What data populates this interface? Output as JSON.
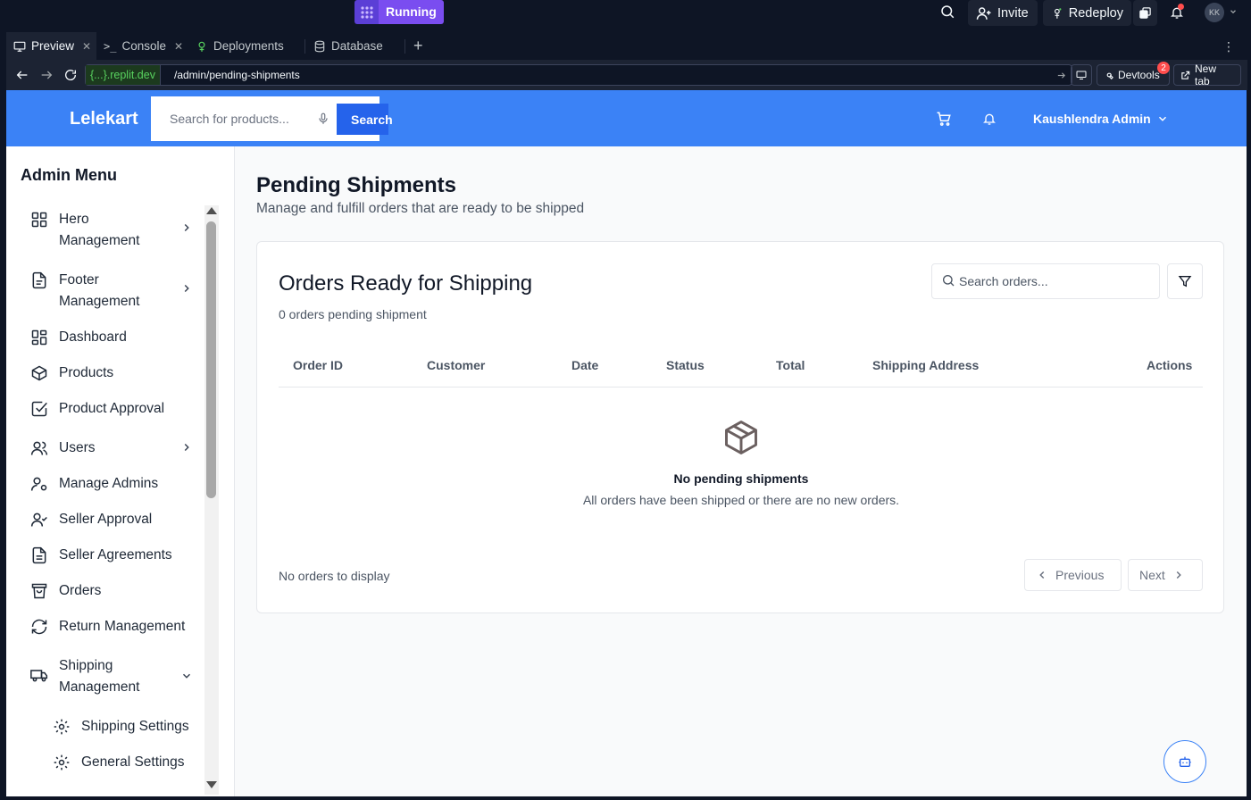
{
  "ide": {
    "run_status": "Running",
    "invite_label": "Invite",
    "redeploy_label": "Redeploy",
    "avatar_initials": "KK",
    "tabs": [
      {
        "label": "Preview",
        "icon": "monitor-icon",
        "active": true
      },
      {
        "label": "Console",
        "icon": "terminal-icon",
        "active": false
      },
      {
        "label": "Deployments",
        "icon": "deploy-icon",
        "active": false
      },
      {
        "label": "Database",
        "icon": "database-icon",
        "active": false
      }
    ],
    "url": {
      "domain": "{...}.replit.dev",
      "path": "/admin/pending-shipments"
    },
    "devtools_label": "Devtools",
    "devtools_badge": "2",
    "new_tab_label": "New tab",
    "accent": "#7a4df0"
  },
  "header": {
    "brand": "Lelekart",
    "search_placeholder": "Search for products...",
    "search_button": "Search",
    "user_name": "Kaushlendra Admin",
    "color": "#3b82f6"
  },
  "sidebar": {
    "title": "Admin Menu",
    "items": [
      {
        "label": "Hero\nManagement",
        "icon": "grid-icon",
        "chevron": "right"
      },
      {
        "label": "Footer\nManagement",
        "icon": "document-icon",
        "chevron": "right"
      },
      {
        "label": "Dashboard",
        "icon": "dashboard-icon"
      },
      {
        "label": "Products",
        "icon": "package-icon"
      },
      {
        "label": "Product Approval",
        "icon": "checkbox-icon"
      },
      {
        "label": "Users",
        "icon": "users-icon",
        "chevron": "right"
      },
      {
        "label": "Manage Admins",
        "icon": "user-cog-icon"
      },
      {
        "label": "Seller Approval",
        "icon": "user-check-icon"
      },
      {
        "label": "Seller Agreements",
        "icon": "file-text-icon"
      },
      {
        "label": "Orders",
        "icon": "shopping-bag-icon"
      },
      {
        "label": "Return Management",
        "icon": "refresh-icon"
      },
      {
        "label": "Shipping\nManagement",
        "icon": "truck-icon",
        "chevron": "down"
      }
    ],
    "subitems": [
      {
        "label": "Shipping Settings",
        "icon": "gear-icon"
      },
      {
        "label": "General Settings",
        "icon": "gear-icon"
      }
    ]
  },
  "main": {
    "title": "Pending Shipments",
    "subtitle": "Manage and fulfill orders that are ready to be shipped",
    "card": {
      "title": "Orders Ready for Shipping",
      "count_text": "0 orders pending shipment",
      "search_placeholder": "Search orders...",
      "columns": [
        "Order ID",
        "Customer",
        "Date",
        "Status",
        "Total",
        "Shipping Address",
        "Actions"
      ],
      "empty_title": "No pending shipments",
      "empty_subtitle": "All orders have been shipped or there are no new orders.",
      "footer_text": "No orders to display",
      "prev_label": "Previous",
      "next_label": "Next"
    }
  }
}
